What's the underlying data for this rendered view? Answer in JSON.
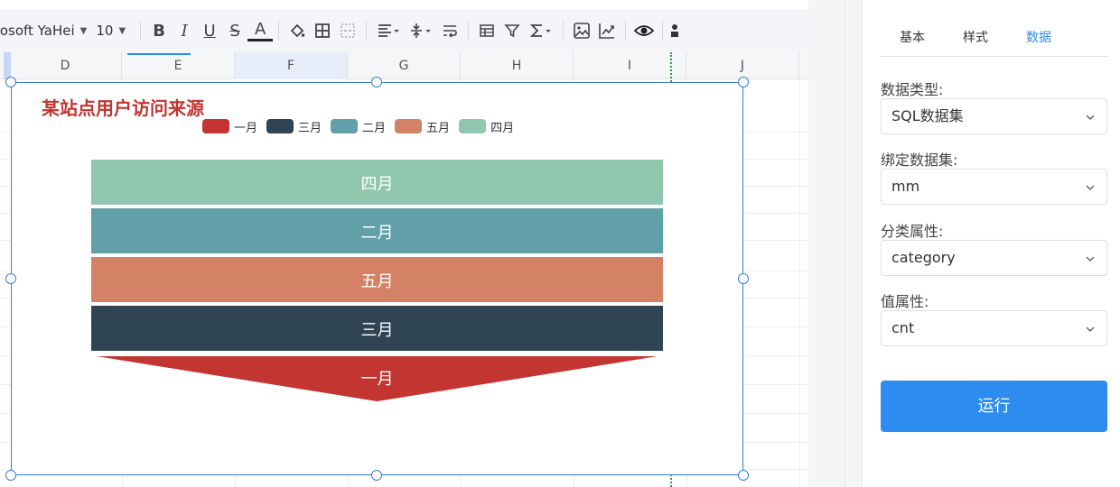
{
  "toolbar": {
    "font_name": "rosoft YaHei",
    "font_size": "10",
    "bold": "B",
    "italic": "I",
    "underline": "U",
    "strike": "S",
    "font_color": "A"
  },
  "columns": [
    {
      "label": "D",
      "selected": false
    },
    {
      "label": "E",
      "selected": false
    },
    {
      "label": "F",
      "selected": true
    },
    {
      "label": "G",
      "selected": false
    },
    {
      "label": "H",
      "selected": false
    },
    {
      "label": "I",
      "selected": false
    },
    {
      "label": "J",
      "selected": false
    }
  ],
  "chart_data": {
    "type": "funnel",
    "title": "某站点用户访问来源",
    "legend": [
      {
        "name": "一月",
        "color": "#c23531"
      },
      {
        "name": "三月",
        "color": "#2f4554"
      },
      {
        "name": "二月",
        "color": "#61a0a8"
      },
      {
        "name": "五月",
        "color": "#d48265"
      },
      {
        "name": "四月",
        "color": "#91c7ae"
      }
    ],
    "stages": [
      {
        "name": "四月",
        "color": "#91c7ae"
      },
      {
        "name": "二月",
        "color": "#61a0a8"
      },
      {
        "name": "五月",
        "color": "#d48265"
      },
      {
        "name": "三月",
        "color": "#2f4554"
      },
      {
        "name": "一月",
        "color": "#c23531"
      }
    ]
  },
  "panel": {
    "tabs": [
      {
        "label": "基本",
        "active": false
      },
      {
        "label": "样式",
        "active": false
      },
      {
        "label": "数据",
        "active": true
      }
    ],
    "fields": [
      {
        "label": "数据类型:",
        "value": "SQL数据集"
      },
      {
        "label": "绑定数据集:",
        "value": "mm"
      },
      {
        "label": "分类属性:",
        "value": "category"
      },
      {
        "label": "值属性:",
        "value": "cnt"
      }
    ],
    "run_label": "运行"
  },
  "colors": {
    "accent": "#2d8cf0",
    "selection": "#3a7bd5",
    "title": "#c23531"
  }
}
